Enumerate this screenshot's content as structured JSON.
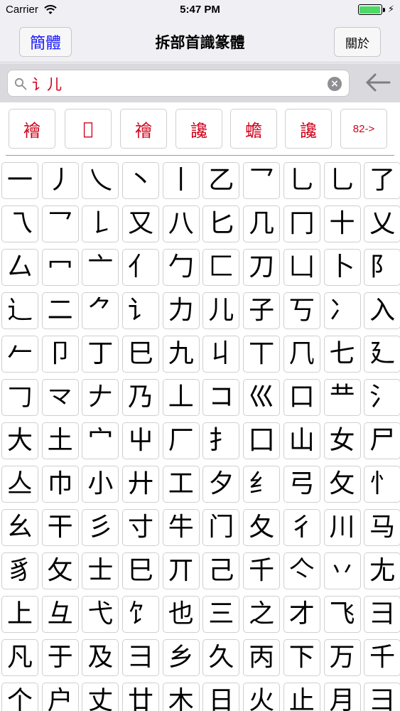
{
  "status_bar": {
    "carrier": "Carrier",
    "time": "5:47 PM",
    "battery_level": 1.0,
    "battery_color": "#4cd964"
  },
  "nav": {
    "left_button": "簡體",
    "title": "拆部首識篆體",
    "right_button": "關於",
    "accent_color": "#1a1aff"
  },
  "search": {
    "value": "讠儿",
    "icon": "search-icon",
    "clear_icon": "clear-icon",
    "back_icon": "back-arrow-icon"
  },
  "results": {
    "items": [
      "襘",
      "𦧌",
      "禬",
      "讒",
      "蟾",
      "讒"
    ],
    "more": "82->",
    "color": "#d0021b"
  },
  "components": [
    "一",
    "丿",
    "乀",
    "丶",
    "丨",
    "乙",
    "乛",
    "乚",
    "乚",
    "了",
    "乁",
    "乛",
    "𠄌",
    "又",
    "八",
    "匕",
    "几",
    "冂",
    "十",
    "乂",
    "厶",
    "冖",
    "亠",
    "亻",
    "勹",
    "匚",
    "刀",
    "凵",
    "卜",
    "阝",
    "辶",
    "二",
    "⺈",
    "讠",
    "力",
    "儿",
    "子",
    "丂",
    "冫",
    "入",
    "𠂉",
    "卩",
    "丁",
    "巳",
    "九",
    "丩",
    "丅",
    "𠘨",
    "七",
    "廴",
    "𠃌",
    "龴",
    "𠂇",
    "乃",
    "丄",
    "コ",
    "巛",
    "口",
    "龷",
    "氵",
    "大",
    "土",
    "宀",
    "屮",
    "厂",
    "扌",
    "囗",
    "山",
    "女",
    "尸",
    "亼",
    "巾",
    "小",
    "廾",
    "工",
    "夕",
    "纟",
    "弓",
    "攵",
    "忄",
    "幺",
    "干",
    "彡",
    "寸",
    "牛",
    "门",
    "夂",
    "彳",
    "川",
    "马",
    "豸",
    "攵",
    "士",
    "巳",
    "丌",
    "己",
    "千",
    "亽",
    "丷",
    "尢",
    "上",
    "彑",
    "弋",
    "饣",
    "也",
    "三",
    "之",
    "才",
    "飞",
    "彐",
    "凡",
    "于",
    "及",
    "⺕",
    "乡",
    "久",
    "丙",
    "下",
    "万",
    "千",
    "个",
    "户",
    "丈",
    "廿",
    "木",
    "日",
    "火",
    "止",
    "月",
    "彐"
  ]
}
